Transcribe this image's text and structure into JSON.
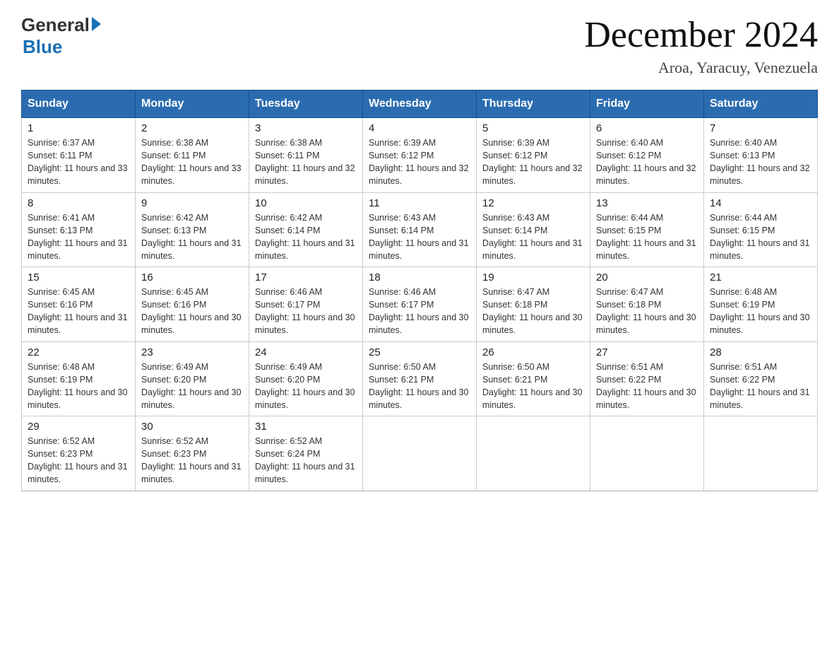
{
  "header": {
    "logo_general": "General",
    "logo_blue": "Blue",
    "month_title": "December 2024",
    "location": "Aroa, Yaracuy, Venezuela"
  },
  "calendar": {
    "days_of_week": [
      "Sunday",
      "Monday",
      "Tuesday",
      "Wednesday",
      "Thursday",
      "Friday",
      "Saturday"
    ],
    "weeks": [
      [
        {
          "day": "1",
          "sunrise": "6:37 AM",
          "sunset": "6:11 PM",
          "daylight": "11 hours and 33 minutes."
        },
        {
          "day": "2",
          "sunrise": "6:38 AM",
          "sunset": "6:11 PM",
          "daylight": "11 hours and 33 minutes."
        },
        {
          "day": "3",
          "sunrise": "6:38 AM",
          "sunset": "6:11 PM",
          "daylight": "11 hours and 32 minutes."
        },
        {
          "day": "4",
          "sunrise": "6:39 AM",
          "sunset": "6:12 PM",
          "daylight": "11 hours and 32 minutes."
        },
        {
          "day": "5",
          "sunrise": "6:39 AM",
          "sunset": "6:12 PM",
          "daylight": "11 hours and 32 minutes."
        },
        {
          "day": "6",
          "sunrise": "6:40 AM",
          "sunset": "6:12 PM",
          "daylight": "11 hours and 32 minutes."
        },
        {
          "day": "7",
          "sunrise": "6:40 AM",
          "sunset": "6:13 PM",
          "daylight": "11 hours and 32 minutes."
        }
      ],
      [
        {
          "day": "8",
          "sunrise": "6:41 AM",
          "sunset": "6:13 PM",
          "daylight": "11 hours and 31 minutes."
        },
        {
          "day": "9",
          "sunrise": "6:42 AM",
          "sunset": "6:13 PM",
          "daylight": "11 hours and 31 minutes."
        },
        {
          "day": "10",
          "sunrise": "6:42 AM",
          "sunset": "6:14 PM",
          "daylight": "11 hours and 31 minutes."
        },
        {
          "day": "11",
          "sunrise": "6:43 AM",
          "sunset": "6:14 PM",
          "daylight": "11 hours and 31 minutes."
        },
        {
          "day": "12",
          "sunrise": "6:43 AM",
          "sunset": "6:14 PM",
          "daylight": "11 hours and 31 minutes."
        },
        {
          "day": "13",
          "sunrise": "6:44 AM",
          "sunset": "6:15 PM",
          "daylight": "11 hours and 31 minutes."
        },
        {
          "day": "14",
          "sunrise": "6:44 AM",
          "sunset": "6:15 PM",
          "daylight": "11 hours and 31 minutes."
        }
      ],
      [
        {
          "day": "15",
          "sunrise": "6:45 AM",
          "sunset": "6:16 PM",
          "daylight": "11 hours and 31 minutes."
        },
        {
          "day": "16",
          "sunrise": "6:45 AM",
          "sunset": "6:16 PM",
          "daylight": "11 hours and 30 minutes."
        },
        {
          "day": "17",
          "sunrise": "6:46 AM",
          "sunset": "6:17 PM",
          "daylight": "11 hours and 30 minutes."
        },
        {
          "day": "18",
          "sunrise": "6:46 AM",
          "sunset": "6:17 PM",
          "daylight": "11 hours and 30 minutes."
        },
        {
          "day": "19",
          "sunrise": "6:47 AM",
          "sunset": "6:18 PM",
          "daylight": "11 hours and 30 minutes."
        },
        {
          "day": "20",
          "sunrise": "6:47 AM",
          "sunset": "6:18 PM",
          "daylight": "11 hours and 30 minutes."
        },
        {
          "day": "21",
          "sunrise": "6:48 AM",
          "sunset": "6:19 PM",
          "daylight": "11 hours and 30 minutes."
        }
      ],
      [
        {
          "day": "22",
          "sunrise": "6:48 AM",
          "sunset": "6:19 PM",
          "daylight": "11 hours and 30 minutes."
        },
        {
          "day": "23",
          "sunrise": "6:49 AM",
          "sunset": "6:20 PM",
          "daylight": "11 hours and 30 minutes."
        },
        {
          "day": "24",
          "sunrise": "6:49 AM",
          "sunset": "6:20 PM",
          "daylight": "11 hours and 30 minutes."
        },
        {
          "day": "25",
          "sunrise": "6:50 AM",
          "sunset": "6:21 PM",
          "daylight": "11 hours and 30 minutes."
        },
        {
          "day": "26",
          "sunrise": "6:50 AM",
          "sunset": "6:21 PM",
          "daylight": "11 hours and 30 minutes."
        },
        {
          "day": "27",
          "sunrise": "6:51 AM",
          "sunset": "6:22 PM",
          "daylight": "11 hours and 30 minutes."
        },
        {
          "day": "28",
          "sunrise": "6:51 AM",
          "sunset": "6:22 PM",
          "daylight": "11 hours and 31 minutes."
        }
      ],
      [
        {
          "day": "29",
          "sunrise": "6:52 AM",
          "sunset": "6:23 PM",
          "daylight": "11 hours and 31 minutes."
        },
        {
          "day": "30",
          "sunrise": "6:52 AM",
          "sunset": "6:23 PM",
          "daylight": "11 hours and 31 minutes."
        },
        {
          "day": "31",
          "sunrise": "6:52 AM",
          "sunset": "6:24 PM",
          "daylight": "11 hours and 31 minutes."
        },
        null,
        null,
        null,
        null
      ]
    ]
  }
}
